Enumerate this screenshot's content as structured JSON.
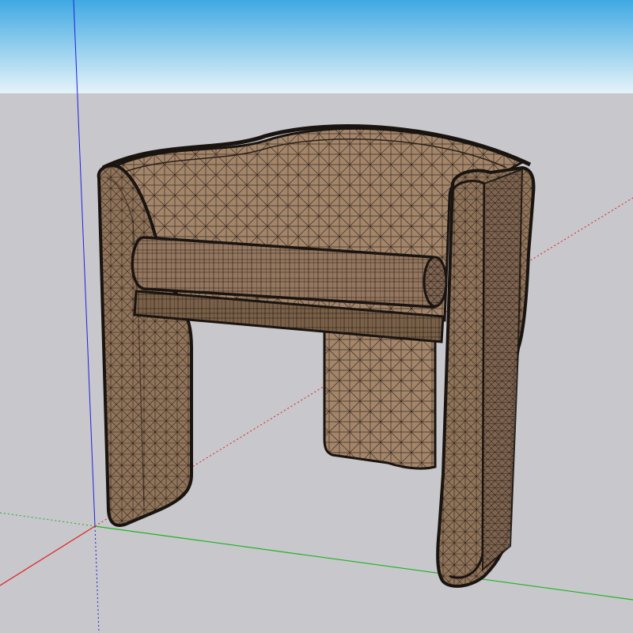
{
  "viewport": {
    "sky_top": "#3fa9e3",
    "sky_bottom": "#e4f2f8",
    "ground": "#c7c7cc",
    "axis_red": "#e02020",
    "axis_green": "#1fb31f",
    "axis_blue": "#2020e0"
  },
  "model": {
    "name": "chair-icon",
    "style": "wireframe-mesh",
    "fabric": "#a08266",
    "fabric_dark": "#6a5240",
    "edge": "#1a1410",
    "mesh_line": "#2a2018"
  }
}
